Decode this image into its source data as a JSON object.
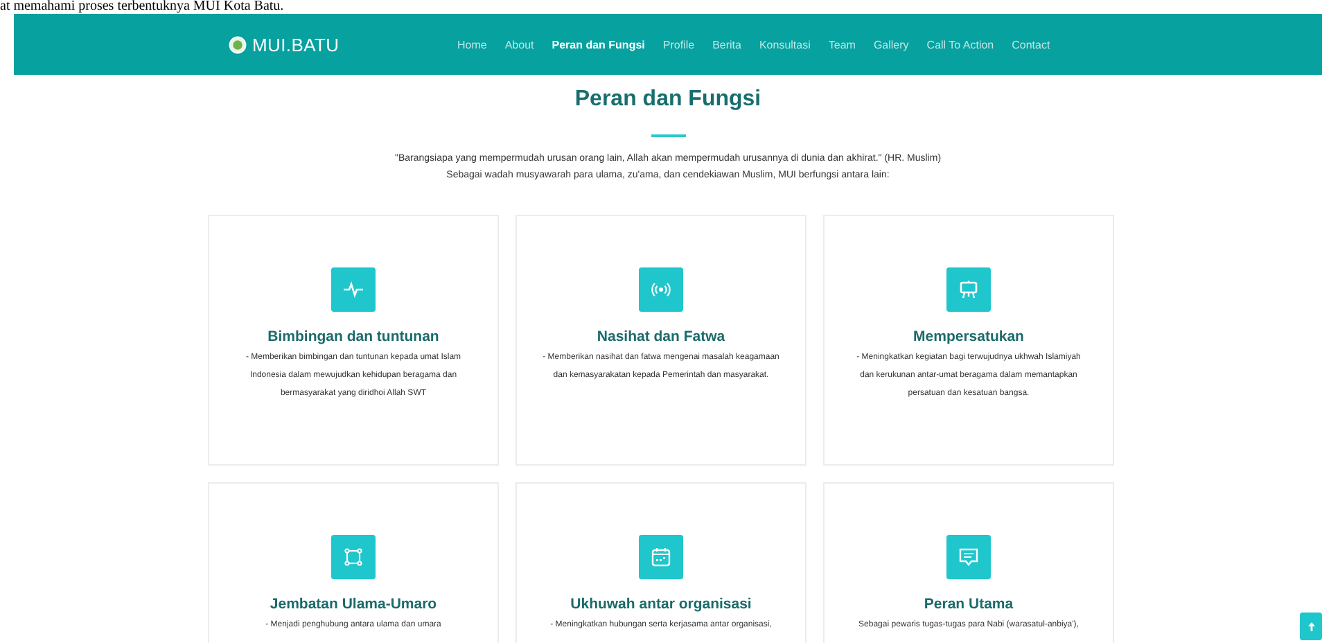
{
  "document_line": "at memahami proses terbentuknya MUI Kota Batu.",
  "navbar": {
    "logo": "MUI.BATU",
    "items": [
      {
        "label": "Home",
        "selected": false
      },
      {
        "label": "About",
        "selected": false
      },
      {
        "label": "Peran dan Fungsi",
        "selected": true
      },
      {
        "label": "Profile",
        "selected": false
      },
      {
        "label": "Berita",
        "selected": false
      },
      {
        "label": "Konsultasi",
        "selected": false
      },
      {
        "label": "Team",
        "selected": false
      },
      {
        "label": "Gallery",
        "selected": false
      },
      {
        "label": "Call To Action",
        "selected": false
      },
      {
        "label": "Contact",
        "selected": false
      }
    ]
  },
  "section": {
    "title": "Peran dan Fungsi",
    "intro": [
      "\"Barangsiapa yang mempermudah urusan orang lain, Allah akan mempermudah urusannya di dunia dan akhirat.\" (HR. Muslim)",
      "Sebagai wadah musyawarah para ulama, zu'ama, dan cendekiawan Muslim, MUI berfungsi antara lain:"
    ]
  },
  "cards": [
    {
      "title": "Bimbingan dan tuntunan",
      "text": "- Memberikan bimbingan dan tuntunan kepada umat Islam Indonesia dalam mewujudkan kehidupan beragama dan bermasyarakat yang diridhoi Allah SWT"
    },
    {
      "title": "Nasihat dan Fatwa",
      "text": "- Memberikan nasihat dan fatwa mengenai masalah keagamaan dan kemasyarakatan kepada Pemerintah dan masyarakat."
    },
    {
      "title": "Mempersatukan",
      "text": "- Meningkatkan kegiatan bagi terwujudnya ukhwah Islamiyah dan kerukunan antar-umat beragama dalam memantapkan persatuan dan kesatuan bangsa."
    },
    {
      "title": "Jembatan Ulama-Umaro",
      "text": "- Menjadi penghubung antara ulama dan umara"
    },
    {
      "title": "Ukhuwah antar organisasi",
      "text": "- Meningkatkan hubungan serta kerjasama antar organisasi,"
    },
    {
      "title": "Peran Utama",
      "text": "Sebagai pewaris tugas-tugas para Nabi (warasatul-anbiya'),"
    }
  ]
}
